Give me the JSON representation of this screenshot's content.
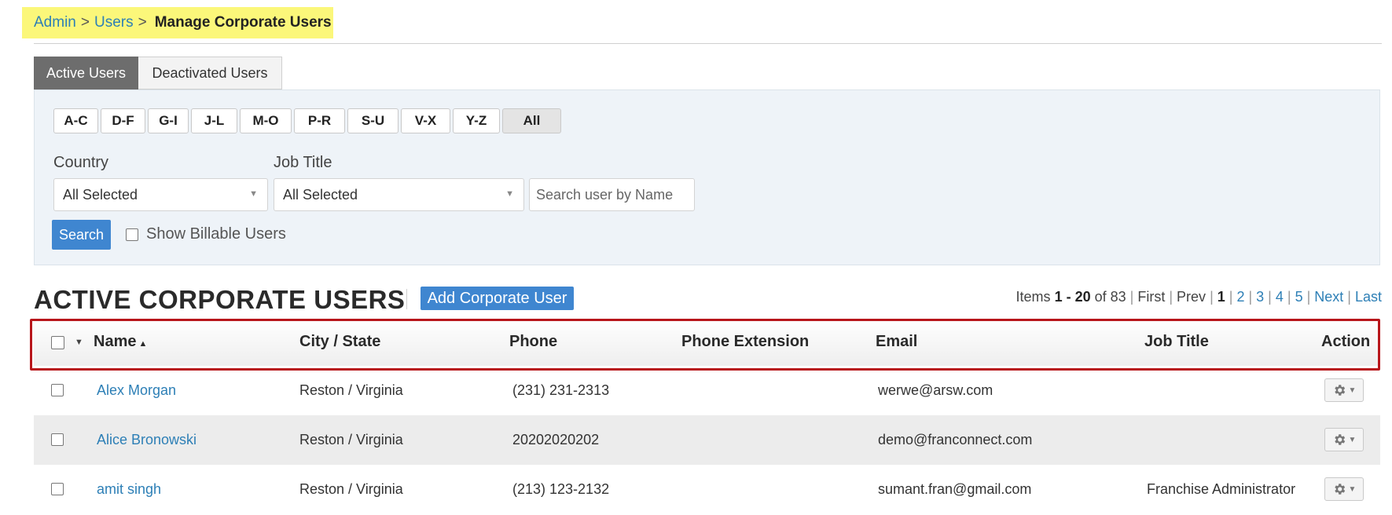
{
  "breadcrumb": {
    "admin": "Admin",
    "users": "Users",
    "sep": ">",
    "current": "Manage Corporate Users"
  },
  "tabs": [
    {
      "label": "Active Users",
      "active": true
    },
    {
      "label": "Deactivated Users",
      "active": false
    }
  ],
  "letters": [
    "A-C",
    "D-F",
    "G-I",
    "J-L",
    "M-O",
    "P-R",
    "S-U",
    "V-X",
    "Y-Z",
    "All"
  ],
  "filters": {
    "country_label": "Country",
    "country_value": "All Selected",
    "job_title_label": "Job Title",
    "job_title_value": "All Selected",
    "search_placeholder": "Search user by Name",
    "search_button": "Search",
    "billable_label": "Show Billable Users"
  },
  "section": {
    "title": "ACTIVE CORPORATE USERS",
    "add_button": "Add Corporate User"
  },
  "pager": {
    "items_label": "Items",
    "range": "1 - 20",
    "of_label": "of",
    "total": "83",
    "first": "First",
    "prev": "Prev",
    "current": "1",
    "pages": [
      "2",
      "3",
      "4",
      "5"
    ],
    "next": "Next",
    "last": "Last"
  },
  "table": {
    "columns": {
      "name": "Name",
      "city_state": "City / State",
      "phone": "Phone",
      "phone_ext": "Phone Extension",
      "email": "Email",
      "job_title": "Job Title",
      "action": "Action"
    },
    "rows": [
      {
        "name": "Alex Morgan",
        "city_state": "Reston / Virginia",
        "phone": "(231) 231-2313",
        "phone_ext": "",
        "email": "werwe@arsw.com",
        "job_title": ""
      },
      {
        "name": "Alice Bronowski",
        "city_state": "Reston / Virginia",
        "phone": "20202020202",
        "phone_ext": "",
        "email": "demo@franconnect.com",
        "job_title": ""
      },
      {
        "name": "amit singh",
        "city_state": "Reston / Virginia",
        "phone": "(213) 123-2132",
        "phone_ext": "",
        "email": "sumant.fran@gmail.com",
        "job_title": "Franchise Administrator"
      }
    ]
  },
  "colors": {
    "link": "#2d7fb6",
    "primary_button": "#3f86d0",
    "breadcrumb_highlight": "#fbf77a",
    "annotation_box": "#b8161b"
  },
  "icons": {
    "sort": "sort-ascending-icon",
    "gear": "gear-icon",
    "dropdown": "chevron-down-icon"
  }
}
